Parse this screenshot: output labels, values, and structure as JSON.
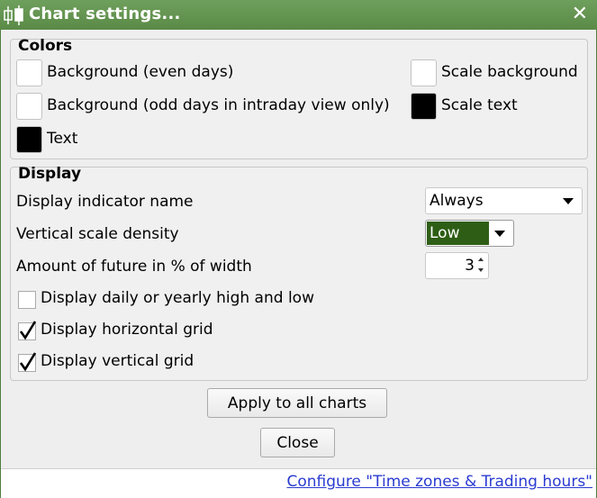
{
  "title": "Chart settings...",
  "colors": {
    "legend": "Colors",
    "background_even_label": "Background (even days)",
    "background_odd_label": "Background (odd days in intraday view only)",
    "text_label": "Text",
    "scale_background_label": "Scale background",
    "scale_text_label": "Scale text",
    "background_even_color": "#ffffff",
    "background_odd_color": "#ffffff",
    "text_color": "#000000",
    "scale_background_color": "#ffffff",
    "scale_text_color": "#000000"
  },
  "display": {
    "legend": "Display",
    "indicator_name_label": "Display indicator name",
    "indicator_name_value": "Always",
    "scale_density_label": "Vertical scale density",
    "scale_density_value": "Low",
    "future_label": "Amount of future in % of width",
    "future_value": "3",
    "high_low_label": "Display daily or yearly high and low",
    "high_low_checked": false,
    "horizontal_grid_label": "Display horizontal grid",
    "horizontal_grid_checked": true,
    "vertical_grid_label": "Display vertical grid",
    "vertical_grid_checked": true
  },
  "buttons": {
    "apply_all": "Apply to all charts",
    "close": "Close"
  },
  "footer": {
    "link": "Configure \"Time zones & Trading hours\""
  },
  "theme": {
    "titlebar_color": "#5e8e4a",
    "selected_green": "#2e5e15",
    "link_color": "#2a3bd1"
  }
}
